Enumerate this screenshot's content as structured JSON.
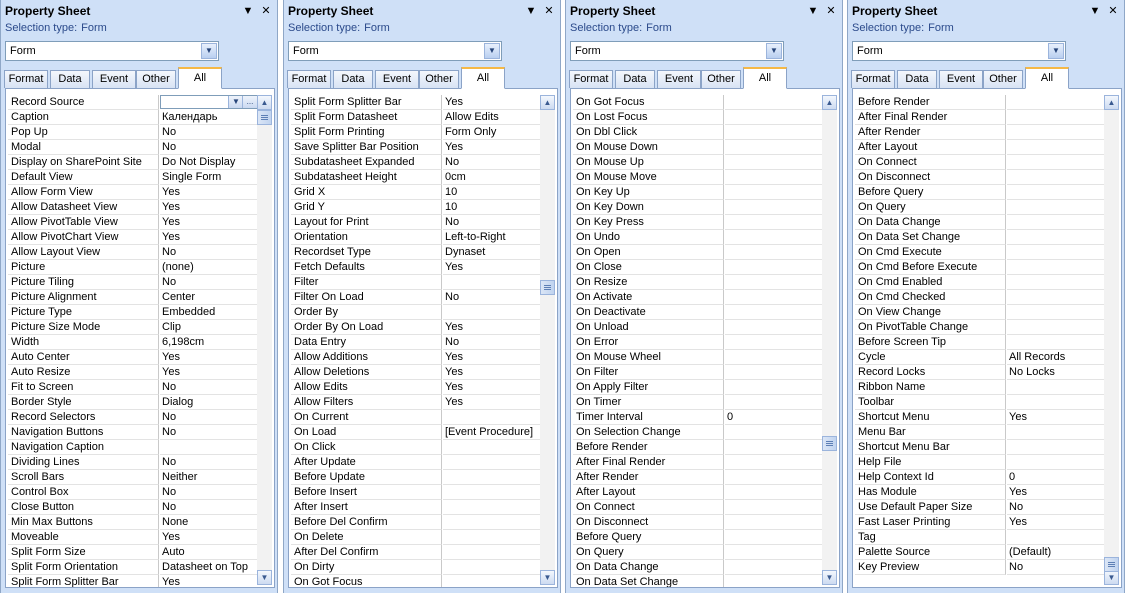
{
  "panels": [
    {
      "title": "Property Sheet",
      "selection_type_label": "Selection type:",
      "selection_type_value": "Form",
      "combo_value": "Form",
      "tabs": [
        "Format",
        "Data",
        "Event",
        "Other",
        "All"
      ],
      "active_tab": "All",
      "rows": [
        {
          "name": "Record Source",
          "value": ""
        },
        {
          "name": "Caption",
          "value": "Календарь"
        },
        {
          "name": "Pop Up",
          "value": "No"
        },
        {
          "name": "Modal",
          "value": "No"
        },
        {
          "name": "Display on SharePoint Site",
          "value": "Do Not Display"
        },
        {
          "name": "Default View",
          "value": "Single Form"
        },
        {
          "name": "Allow Form View",
          "value": "Yes"
        },
        {
          "name": "Allow Datasheet View",
          "value": "Yes"
        },
        {
          "name": "Allow PivotTable View",
          "value": "Yes"
        },
        {
          "name": "Allow PivotChart View",
          "value": "Yes"
        },
        {
          "name": "Allow Layout View",
          "value": "No"
        },
        {
          "name": "Picture",
          "value": "(none)"
        },
        {
          "name": "Picture Tiling",
          "value": "No"
        },
        {
          "name": "Picture Alignment",
          "value": "Center"
        },
        {
          "name": "Picture Type",
          "value": "Embedded"
        },
        {
          "name": "Picture Size Mode",
          "value": "Clip"
        },
        {
          "name": "Width",
          "value": "6,198cm"
        },
        {
          "name": "Auto Center",
          "value": "Yes"
        },
        {
          "name": "Auto Resize",
          "value": "Yes"
        },
        {
          "name": "Fit to Screen",
          "value": "No"
        },
        {
          "name": "Border Style",
          "value": "Dialog"
        },
        {
          "name": "Record Selectors",
          "value": "No"
        },
        {
          "name": "Navigation Buttons",
          "value": "No"
        },
        {
          "name": "Navigation Caption",
          "value": ""
        },
        {
          "name": "Dividing Lines",
          "value": "No"
        },
        {
          "name": "Scroll Bars",
          "value": "Neither"
        },
        {
          "name": "Control Box",
          "value": "No"
        },
        {
          "name": "Close Button",
          "value": "No"
        },
        {
          "name": "Min Max Buttons",
          "value": "None"
        },
        {
          "name": "Moveable",
          "value": "Yes"
        },
        {
          "name": "Split Form Size",
          "value": "Auto"
        },
        {
          "name": "Split Form Orientation",
          "value": "Datasheet on Top"
        },
        {
          "name": "Split Form Splitter Bar",
          "value": "Yes"
        }
      ],
      "scroll_position": 0.0
    },
    {
      "title": "Property Sheet",
      "selection_type_label": "Selection type:",
      "selection_type_value": "Form",
      "combo_value": "Form",
      "tabs": [
        "Format",
        "Data",
        "Event",
        "Other",
        "All"
      ],
      "active_tab": "All",
      "rows": [
        {
          "name": "Split Form Splitter Bar",
          "value": "Yes"
        },
        {
          "name": "Split Form Datasheet",
          "value": "Allow Edits"
        },
        {
          "name": "Split Form Printing",
          "value": "Form Only"
        },
        {
          "name": "Save Splitter Bar Position",
          "value": "Yes"
        },
        {
          "name": "Subdatasheet Expanded",
          "value": "No"
        },
        {
          "name": "Subdatasheet Height",
          "value": "0cm"
        },
        {
          "name": "Grid X",
          "value": "10"
        },
        {
          "name": "Grid Y",
          "value": "10"
        },
        {
          "name": "Layout for Print",
          "value": "No"
        },
        {
          "name": "Orientation",
          "value": "Left-to-Right"
        },
        {
          "name": "Recordset Type",
          "value": "Dynaset"
        },
        {
          "name": "Fetch Defaults",
          "value": "Yes"
        },
        {
          "name": "Filter",
          "value": ""
        },
        {
          "name": "Filter On Load",
          "value": "No"
        },
        {
          "name": "Order By",
          "value": ""
        },
        {
          "name": "Order By On Load",
          "value": "Yes"
        },
        {
          "name": "Data Entry",
          "value": "No"
        },
        {
          "name": "Allow Additions",
          "value": "Yes"
        },
        {
          "name": "Allow Deletions",
          "value": "Yes"
        },
        {
          "name": "Allow Edits",
          "value": "Yes"
        },
        {
          "name": "Allow Filters",
          "value": "Yes"
        },
        {
          "name": "On Current",
          "value": ""
        },
        {
          "name": "On Load",
          "value": "[Event Procedure]"
        },
        {
          "name": "On Click",
          "value": ""
        },
        {
          "name": "After Update",
          "value": ""
        },
        {
          "name": "Before Update",
          "value": ""
        },
        {
          "name": "Before Insert",
          "value": ""
        },
        {
          "name": "After Insert",
          "value": ""
        },
        {
          "name": "Before Del Confirm",
          "value": ""
        },
        {
          "name": "On Delete",
          "value": ""
        },
        {
          "name": "After Del Confirm",
          "value": ""
        },
        {
          "name": "On Dirty",
          "value": ""
        },
        {
          "name": "On Got Focus",
          "value": ""
        }
      ],
      "scroll_position": 0.38
    },
    {
      "title": "Property Sheet",
      "selection_type_label": "Selection type:",
      "selection_type_value": "Form",
      "combo_value": "Form",
      "tabs": [
        "Format",
        "Data",
        "Event",
        "Other",
        "All"
      ],
      "active_tab": "All",
      "rows": [
        {
          "name": "On Got Focus",
          "value": ""
        },
        {
          "name": "On Lost Focus",
          "value": ""
        },
        {
          "name": "On Dbl Click",
          "value": ""
        },
        {
          "name": "On Mouse Down",
          "value": ""
        },
        {
          "name": "On Mouse Up",
          "value": ""
        },
        {
          "name": "On Mouse Move",
          "value": ""
        },
        {
          "name": "On Key Up",
          "value": ""
        },
        {
          "name": "On Key Down",
          "value": ""
        },
        {
          "name": "On Key Press",
          "value": ""
        },
        {
          "name": "On Undo",
          "value": ""
        },
        {
          "name": "On Open",
          "value": ""
        },
        {
          "name": "On Close",
          "value": ""
        },
        {
          "name": "On Resize",
          "value": ""
        },
        {
          "name": "On Activate",
          "value": ""
        },
        {
          "name": "On Deactivate",
          "value": ""
        },
        {
          "name": "On Unload",
          "value": ""
        },
        {
          "name": "On Error",
          "value": ""
        },
        {
          "name": "On Mouse Wheel",
          "value": ""
        },
        {
          "name": "On Filter",
          "value": ""
        },
        {
          "name": "On Apply Filter",
          "value": ""
        },
        {
          "name": "On Timer",
          "value": ""
        },
        {
          "name": "Timer Interval",
          "value": "0"
        },
        {
          "name": "On Selection Change",
          "value": ""
        },
        {
          "name": "Before Render",
          "value": ""
        },
        {
          "name": "After Final Render",
          "value": ""
        },
        {
          "name": "After Render",
          "value": ""
        },
        {
          "name": "After Layout",
          "value": ""
        },
        {
          "name": "On Connect",
          "value": ""
        },
        {
          "name": "On Disconnect",
          "value": ""
        },
        {
          "name": "Before Query",
          "value": ""
        },
        {
          "name": "On Query",
          "value": ""
        },
        {
          "name": "On Data Change",
          "value": ""
        },
        {
          "name": "On Data Set Change",
          "value": ""
        }
      ],
      "scroll_position": 0.73
    },
    {
      "title": "Property Sheet",
      "selection_type_label": "Selection type:",
      "selection_type_value": "Form",
      "combo_value": "Form",
      "tabs": [
        "Format",
        "Data",
        "Event",
        "Other",
        "All"
      ],
      "active_tab": "All",
      "rows": [
        {
          "name": "Before Render",
          "value": ""
        },
        {
          "name": "After Final Render",
          "value": ""
        },
        {
          "name": "After Render",
          "value": ""
        },
        {
          "name": "After Layout",
          "value": ""
        },
        {
          "name": "On Connect",
          "value": ""
        },
        {
          "name": "On Disconnect",
          "value": ""
        },
        {
          "name": "Before Query",
          "value": ""
        },
        {
          "name": "On Query",
          "value": ""
        },
        {
          "name": "On Data Change",
          "value": ""
        },
        {
          "name": "On Data Set Change",
          "value": ""
        },
        {
          "name": "On Cmd Execute",
          "value": ""
        },
        {
          "name": "On Cmd Before Execute",
          "value": ""
        },
        {
          "name": "On Cmd Enabled",
          "value": ""
        },
        {
          "name": "On Cmd Checked",
          "value": ""
        },
        {
          "name": "On View Change",
          "value": ""
        },
        {
          "name": "On PivotTable Change",
          "value": ""
        },
        {
          "name": "Before Screen Tip",
          "value": ""
        },
        {
          "name": "Cycle",
          "value": "All Records"
        },
        {
          "name": "Record Locks",
          "value": "No Locks"
        },
        {
          "name": "Ribbon Name",
          "value": ""
        },
        {
          "name": "Toolbar",
          "value": ""
        },
        {
          "name": "Shortcut Menu",
          "value": "Yes"
        },
        {
          "name": "Menu Bar",
          "value": ""
        },
        {
          "name": "Shortcut Menu Bar",
          "value": ""
        },
        {
          "name": "Help File",
          "value": ""
        },
        {
          "name": "Help Context Id",
          "value": "0"
        },
        {
          "name": "Has Module",
          "value": "Yes"
        },
        {
          "name": "Use Default Paper Size",
          "value": "No"
        },
        {
          "name": "Fast Laser Printing",
          "value": "Yes"
        },
        {
          "name": "Tag",
          "value": ""
        },
        {
          "name": "Palette Source",
          "value": "(Default)"
        },
        {
          "name": "Key Preview",
          "value": "No"
        }
      ],
      "scroll_position": 1.0
    }
  ],
  "icons": {
    "dropdown": "▼",
    "close": "✕",
    "builder": "...",
    "scroll_up": "▲",
    "scroll_down": "▼"
  }
}
